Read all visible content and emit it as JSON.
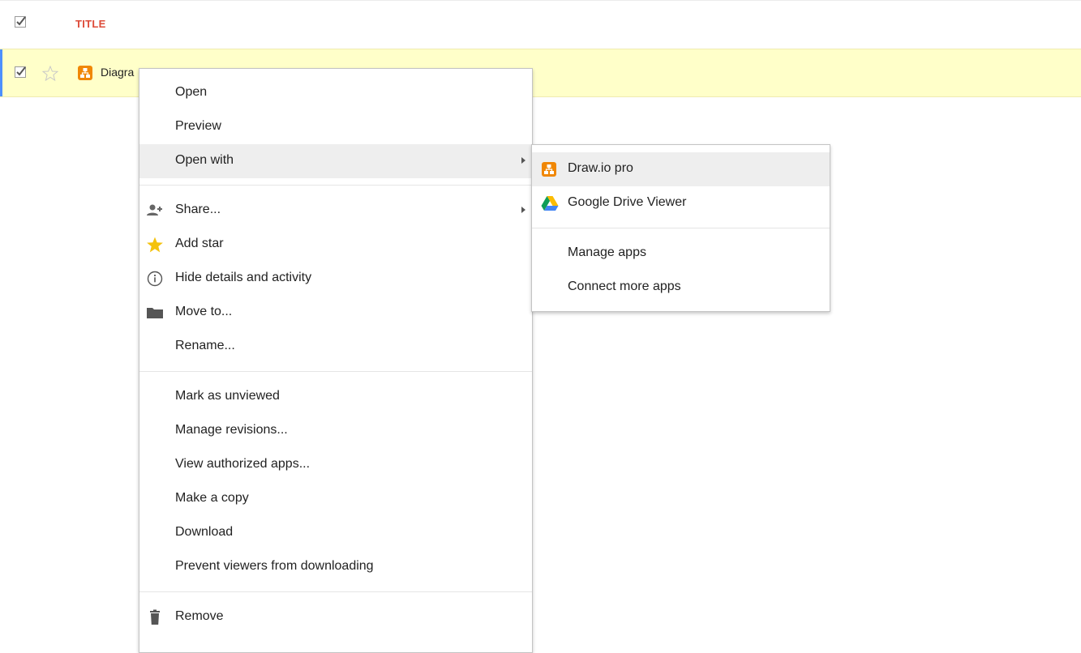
{
  "list": {
    "header": {
      "title_label": "TITLE"
    },
    "file": {
      "name": "Diagra"
    }
  },
  "context_menu": {
    "items": [
      {
        "label": "Open"
      },
      {
        "label": "Preview"
      },
      {
        "label": "Open with"
      },
      {
        "label": "Share..."
      },
      {
        "label": "Add star"
      },
      {
        "label": "Hide details and activity"
      },
      {
        "label": "Move to..."
      },
      {
        "label": "Rename..."
      },
      {
        "label": "Mark as unviewed"
      },
      {
        "label": "Manage revisions..."
      },
      {
        "label": "View authorized apps..."
      },
      {
        "label": "Make a copy"
      },
      {
        "label": "Download"
      },
      {
        "label": "Prevent viewers from downloading"
      },
      {
        "label": "Remove"
      }
    ],
    "highlighted": "Open with"
  },
  "open_with_submenu": {
    "items": [
      {
        "label": "Draw.io pro",
        "icon": "drawio-icon"
      },
      {
        "label": "Google Drive Viewer",
        "icon": "google-drive-icon"
      },
      {
        "label": "Manage apps"
      },
      {
        "label": "Connect more apps"
      }
    ],
    "highlighted": "Draw.io pro"
  },
  "colors": {
    "title_red": "#dd4b39",
    "selected_row": "#ffffc9",
    "selection_bar": "#4d90fe",
    "drawio_orange": "#f08705",
    "star_yellow": "#f4c20d"
  }
}
